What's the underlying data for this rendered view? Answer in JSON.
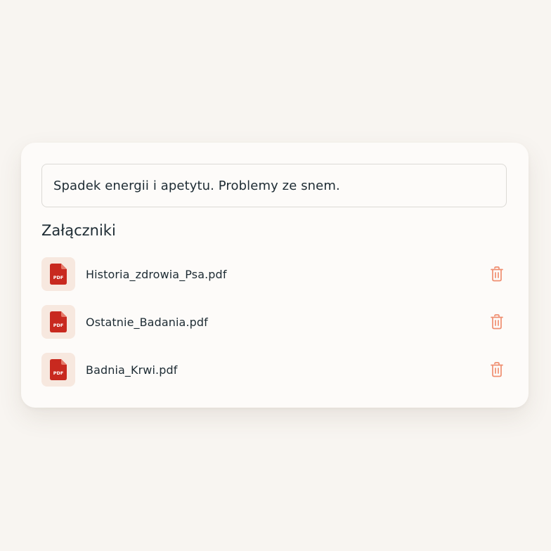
{
  "note": {
    "value": "Spadek energii i apetytu. Problemy ze snem."
  },
  "attachments": {
    "title": "Załączniki",
    "items": [
      {
        "name": "Historia_zdrowia_Psa.pdf",
        "icon": "pdf-file-icon",
        "badge": "PDF"
      },
      {
        "name": "Ostatnie_Badania.pdf",
        "icon": "pdf-file-icon",
        "badge": "PDF"
      },
      {
        "name": "Badnia_Krwi.pdf",
        "icon": "pdf-file-icon",
        "badge": "PDF"
      }
    ],
    "delete_icon": "trash-icon"
  },
  "colors": {
    "background": "#f8f5f1",
    "card": "#fdfbf9",
    "text": "#1d2b33",
    "pdf_red": "#c8291f",
    "icon_box": "#f7e8df",
    "delete_accent": "#ef8e70"
  }
}
